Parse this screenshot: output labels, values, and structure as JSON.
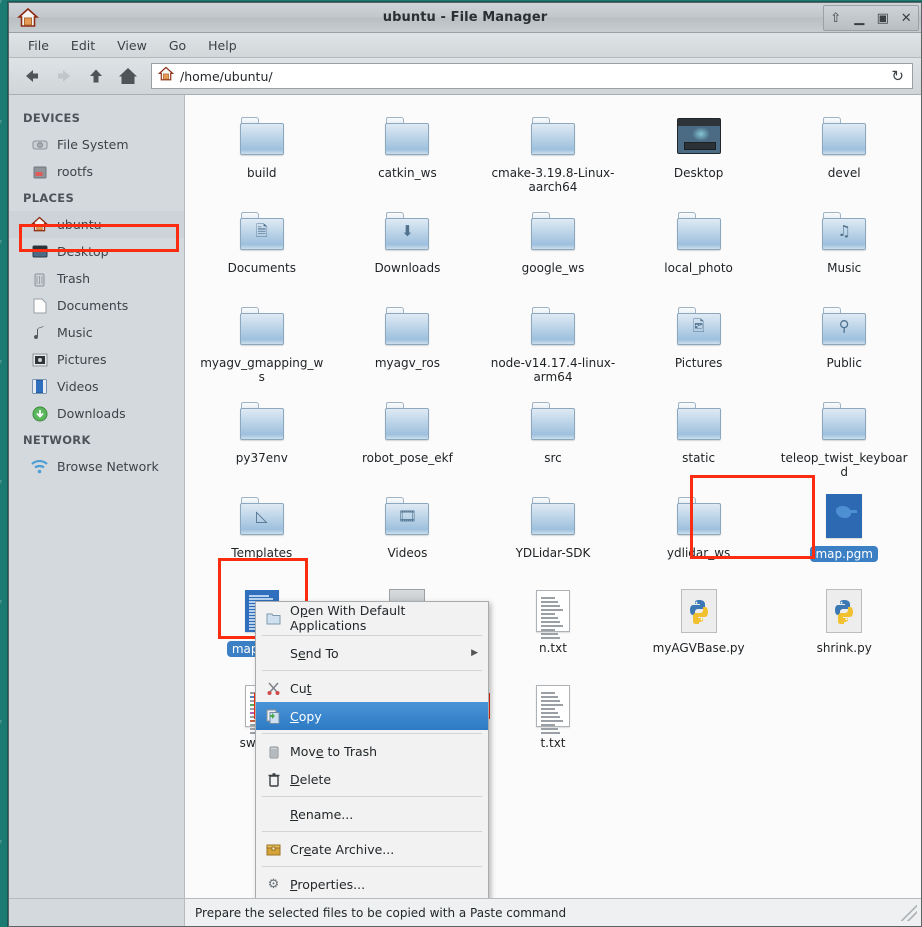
{
  "window": {
    "title": "ubuntu - File Manager",
    "home_icon": "home-icon",
    "buttons": [
      {
        "name": "shade-button",
        "glyph": "⇧"
      },
      {
        "name": "minimize-button",
        "glyph": "▁"
      },
      {
        "name": "maximize-button",
        "glyph": "▣"
      },
      {
        "name": "close-button",
        "glyph": "✕"
      }
    ]
  },
  "menubar": {
    "items": [
      {
        "label": "File",
        "name": "menu-file"
      },
      {
        "label": "Edit",
        "name": "menu-edit"
      },
      {
        "label": "View",
        "name": "menu-view"
      },
      {
        "label": "Go",
        "name": "menu-go"
      },
      {
        "label": "Help",
        "name": "menu-help"
      }
    ]
  },
  "toolbar": {
    "back": "←",
    "forward": "→",
    "up": "↑",
    "home": "⌂",
    "reload": "↻",
    "path": "/home/ubuntu/",
    "path_placeholder": "/home/ubuntu/"
  },
  "sidebar": {
    "groups": [
      {
        "header": "DEVICES",
        "items": [
          {
            "label": "File System",
            "icon": "harddisk-icon",
            "selected": false
          },
          {
            "label": "rootfs",
            "icon": "drive-icon",
            "selected": false
          }
        ]
      },
      {
        "header": "PLACES",
        "items": [
          {
            "label": "ubuntu",
            "icon": "home-icon",
            "selected": true
          },
          {
            "label": "Desktop",
            "icon": "desktop-icon",
            "selected": false
          },
          {
            "label": "Trash",
            "icon": "trash-icon",
            "selected": false
          },
          {
            "label": "Documents",
            "icon": "document-icon",
            "selected": false
          },
          {
            "label": "Music",
            "icon": "music-note-icon",
            "selected": false
          },
          {
            "label": "Pictures",
            "icon": "picture-icon",
            "selected": false
          },
          {
            "label": "Videos",
            "icon": "video-icon",
            "selected": false
          },
          {
            "label": "Downloads",
            "icon": "download-icon",
            "selected": false
          }
        ]
      },
      {
        "header": "NETWORK",
        "items": [
          {
            "label": "Browse Network",
            "icon": "network-icon",
            "selected": false
          }
        ]
      }
    ]
  },
  "files": [
    {
      "label": "build",
      "type": "folder",
      "emblem": "",
      "selected": false
    },
    {
      "label": "catkin_ws",
      "type": "folder",
      "emblem": "",
      "selected": false
    },
    {
      "label": "cmake-3.19.8-Linux-aarch64",
      "type": "folder",
      "emblem": "",
      "selected": false
    },
    {
      "label": "Desktop",
      "type": "desktop",
      "emblem": "",
      "selected": false
    },
    {
      "label": "devel",
      "type": "folder",
      "emblem": "",
      "selected": false
    },
    {
      "label": "Documents",
      "type": "folder",
      "emblem": "🗎",
      "selected": false
    },
    {
      "label": "Downloads",
      "type": "folder",
      "emblem": "⬇",
      "selected": false
    },
    {
      "label": "google_ws",
      "type": "folder",
      "emblem": "",
      "selected": false
    },
    {
      "label": "local_photo",
      "type": "folder",
      "emblem": "",
      "selected": false
    },
    {
      "label": "Music",
      "type": "folder",
      "emblem": "♫",
      "selected": false
    },
    {
      "label": "myagv_gmapping_ws",
      "type": "folder",
      "emblem": "",
      "selected": false
    },
    {
      "label": "myagv_ros",
      "type": "folder",
      "emblem": "",
      "selected": false
    },
    {
      "label": "node-v14.17.4-linux-arm64",
      "type": "folder",
      "emblem": "",
      "selected": false
    },
    {
      "label": "Pictures",
      "type": "folder",
      "emblem": "🖻",
      "selected": false
    },
    {
      "label": "Public",
      "type": "folder",
      "emblem": "⚲",
      "selected": false
    },
    {
      "label": "py37env",
      "type": "folder",
      "emblem": "",
      "selected": false
    },
    {
      "label": "robot_pose_ekf",
      "type": "folder",
      "emblem": "",
      "selected": false
    },
    {
      "label": "src",
      "type": "folder",
      "emblem": "",
      "selected": false
    },
    {
      "label": "static",
      "type": "folder",
      "emblem": "",
      "selected": false
    },
    {
      "label": "teleop_twist_keyboard",
      "type": "folder",
      "emblem": "",
      "selected": false
    },
    {
      "label": "Templates",
      "type": "folder",
      "emblem": "◺",
      "selected": false
    },
    {
      "label": "Videos",
      "type": "folder",
      "emblem": "🎞",
      "selected": false
    },
    {
      "label": "YDLidar-SDK",
      "type": "folder",
      "emblem": "",
      "selected": false
    },
    {
      "label": "ydlidar_ws",
      "type": "folder",
      "emblem": "",
      "selected": false
    },
    {
      "label": "map.pgm",
      "type": "pgm",
      "emblem": "",
      "selected": true
    },
    {
      "label": "map.yaml",
      "type": "yaml",
      "emblem": "",
      "selected": true
    },
    {
      "label": "",
      "type": "gear",
      "emblem": "",
      "selected": false
    },
    {
      "label": "n.txt",
      "type": "doc",
      "emblem": "",
      "selected": false
    },
    {
      "label": "myAGVBase.py",
      "type": "py",
      "emblem": "",
      "selected": false
    },
    {
      "label": "shrink.py",
      "type": "py",
      "emblem": "",
      "selected": false
    },
    {
      "label": "switch_",
      "type": "doccolor",
      "emblem": "",
      "selected": false
    },
    {
      "label": "",
      "type": "hidden",
      "emblem": "",
      "selected": false
    },
    {
      "label": "t.txt",
      "type": "doc",
      "emblem": "",
      "selected": false
    },
    {
      "label": "",
      "type": "hidden",
      "emblem": "",
      "selected": false
    },
    {
      "label": "",
      "type": "hidden",
      "emblem": "",
      "selected": false
    }
  ],
  "context_menu": {
    "items": [
      {
        "label": "Open With Default Applications",
        "icon": "folder-open-icon",
        "active": false,
        "submenu": false,
        "sep_after": true,
        "accel_index": 1
      },
      {
        "label": "Send To",
        "icon": "",
        "active": false,
        "submenu": true,
        "sep_after": true,
        "accel_index": 1
      },
      {
        "label": "Cut",
        "icon": "scissors-icon",
        "active": false,
        "submenu": false,
        "sep_after": false,
        "accel_index": 2
      },
      {
        "label": "Copy",
        "icon": "copy-icon",
        "active": true,
        "submenu": false,
        "sep_after": true,
        "accel_index": 0
      },
      {
        "label": "Move to Trash",
        "icon": "trash-icon",
        "active": false,
        "submenu": false,
        "sep_after": false,
        "accel_index": 3
      },
      {
        "label": "Delete",
        "icon": "delete-icon",
        "active": false,
        "submenu": false,
        "sep_after": true,
        "accel_index": 0
      },
      {
        "label": "Rename...",
        "icon": "",
        "active": false,
        "submenu": false,
        "sep_after": true,
        "accel_index": 0
      },
      {
        "label": "Create Archive...",
        "icon": "archive-icon",
        "active": false,
        "submenu": false,
        "sep_after": true,
        "accel_index": 2
      },
      {
        "label": "Properties...",
        "icon": "gear-icon",
        "active": false,
        "submenu": false,
        "sep_after": false,
        "accel_index": 0
      }
    ]
  },
  "statusbar": {
    "text": "Prepare the selected files to be copied with a Paste command"
  },
  "colors": {
    "desktop": "#1b7a72",
    "highlight_box": "#fb2c10",
    "selection_blue": "#3b7fc4",
    "menu_active": "#2d7ac4"
  }
}
